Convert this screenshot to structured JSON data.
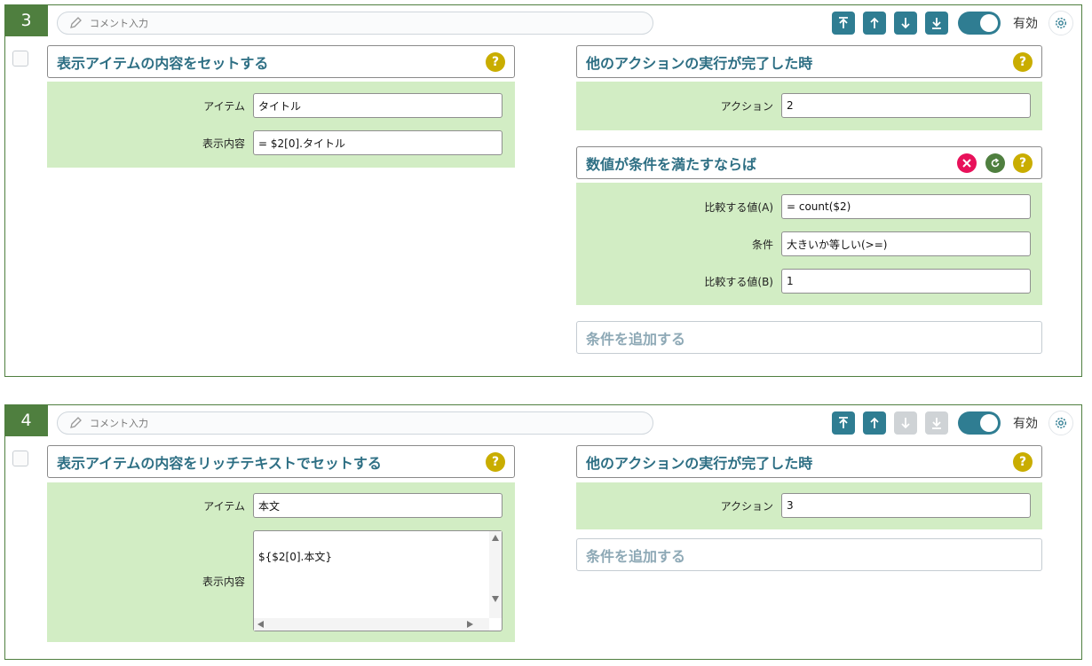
{
  "colors": {
    "green": "#4f7f3f",
    "teal": "#2f7d92",
    "panel": "#d2edc4",
    "help": "#c9ad00",
    "remove": "#e8115a"
  },
  "blocks": [
    {
      "number": "3",
      "comment_placeholder": "コメント入力",
      "toggle_label": "有効",
      "left": {
        "title": "表示アイテムの内容をセットする",
        "fields": [
          {
            "label": "アイテム",
            "value": "タイトル"
          },
          {
            "label": "表示内容",
            "value": "= $2[0].タイトル"
          }
        ]
      },
      "trigger": {
        "title": "他のアクションの実行が完了した時",
        "fields": [
          {
            "label": "アクション",
            "value": "2"
          }
        ]
      },
      "condition": {
        "title": "数値が条件を満たすならば",
        "fields": [
          {
            "label": "比較する値(A)",
            "value": "= count($2)"
          },
          {
            "label": "条件",
            "value": "大きいか等しい(>=)"
          },
          {
            "label": "比較する値(B)",
            "value": "1"
          }
        ]
      },
      "add_condition": "条件を追加する"
    },
    {
      "number": "4",
      "comment_placeholder": "コメント入力",
      "toggle_label": "有効",
      "left": {
        "title": "表示アイテムの内容をリッチテキストでセットする",
        "fields": [
          {
            "label": "アイテム",
            "value": "本文"
          },
          {
            "label": "表示内容",
            "value": "${$2[0].本文}"
          }
        ]
      },
      "trigger": {
        "title": "他のアクションの実行が完了した時",
        "fields": [
          {
            "label": "アクション",
            "value": "3"
          }
        ]
      },
      "add_condition": "条件を追加する"
    }
  ]
}
